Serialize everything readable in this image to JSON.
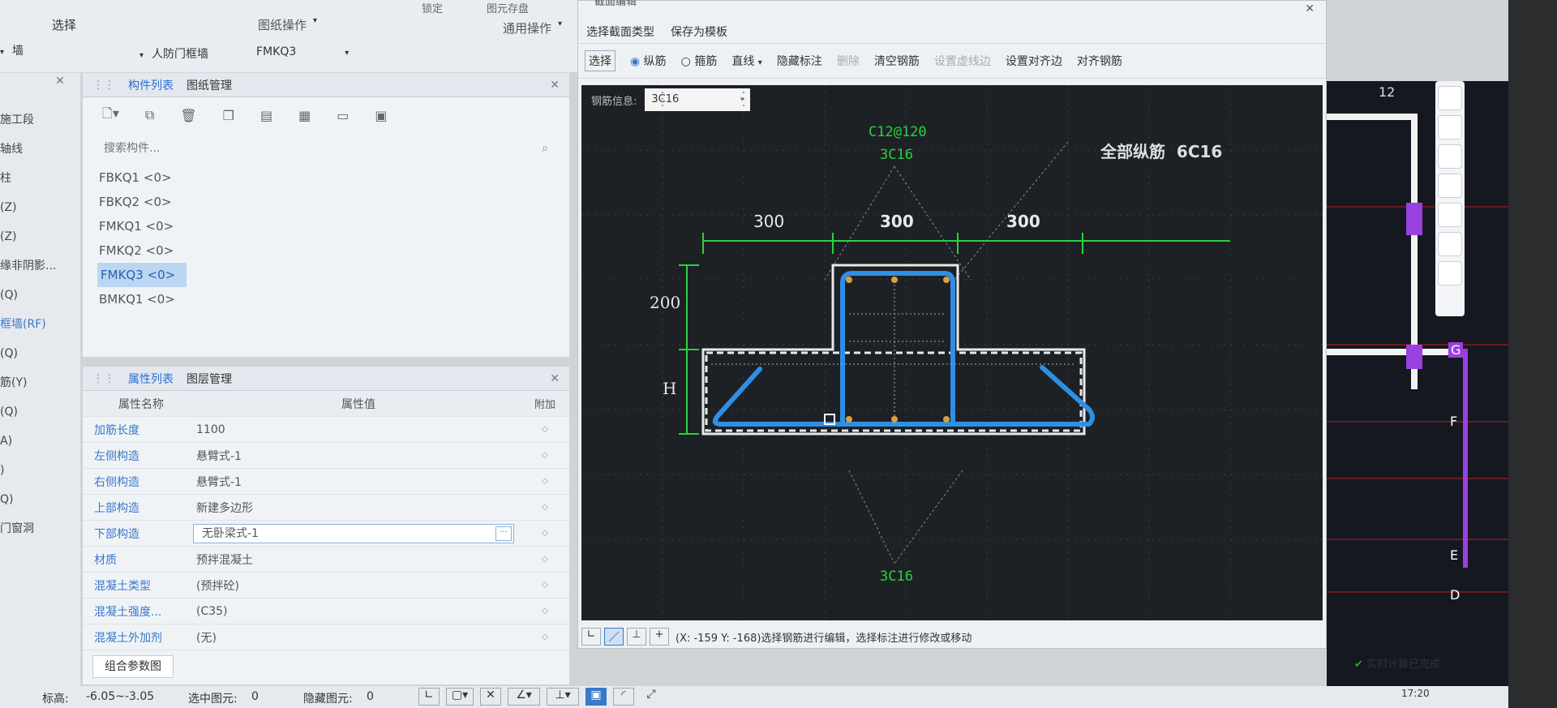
{
  "toolbar": {
    "select_label": "选择",
    "drawing_ops": "图纸操作",
    "general_ops": "通用操作",
    "wall_label": "墙",
    "cat_label": "人防门框墙",
    "comp_label": "FMKQ3",
    "lock_label": "锁定",
    "save_label": "图元存盘"
  },
  "left_menu": [
    "施工段",
    "轴线",
    "柱",
    "(Z)",
    "(Z)",
    "缘非阴影...",
    "(Q)",
    "框墙(RF)",
    "(Q)",
    "筋(Y)",
    "(Q)",
    "A)",
    ")",
    "Q)",
    "门窗洞"
  ],
  "component_panel": {
    "tabs": [
      "构件列表",
      "图纸管理"
    ],
    "search_placeholder": "搜索构件...",
    "items": [
      "FBKQ1 <0>",
      "FBKQ2 <0>",
      "FMKQ1 <0>",
      "FMKQ2 <0>",
      "FMKQ3 <0>",
      "BMKQ1 <0>"
    ],
    "selected_index": 4
  },
  "property_panel": {
    "tabs": [
      "属性列表",
      "图层管理"
    ],
    "headers": [
      "属性名称",
      "属性值",
      "附加"
    ],
    "rows": [
      {
        "name": "加筋长度",
        "value": "1100"
      },
      {
        "name": "左侧构造",
        "value": "悬臂式-1"
      },
      {
        "name": "右侧构造",
        "value": "悬臂式-1"
      },
      {
        "name": "上部构造",
        "value": "新建多边形"
      },
      {
        "name": "下部构造",
        "value": "无卧梁式-1"
      },
      {
        "name": "材质",
        "value": "预拌混凝土"
      },
      {
        "name": "混凝土类型",
        "value": "(预拌砼)"
      },
      {
        "name": "混凝土强度...",
        "value": "(C35)"
      },
      {
        "name": "混凝土外加剂",
        "value": "(无)"
      }
    ],
    "combine_btn": "组合参数图"
  },
  "dialog": {
    "title": "截面编辑",
    "menu": [
      "选择截面类型",
      "保存为模板"
    ],
    "toolbar": {
      "select": "选择",
      "radio_long": "纵筋",
      "radio_stir": "箍筋",
      "line": "直线",
      "hide_label": "隐藏标注",
      "delete": "删除",
      "clear": "清空钢筋",
      "set_dash": "设置虚线边",
      "set_align": "设置对齐边",
      "align_rebar": "对齐钢筋"
    },
    "rebar_info_label": "钢筋信息:",
    "rebar_info_value": "3C16",
    "status_text": "(X: -159 Y: -168)选择钢筋进行编辑，选择标注进行修改或移动"
  },
  "cad": {
    "label_top1": "C12@120",
    "label_top2": "3C16",
    "label_all": "全部纵筋  6C16",
    "dim1": "300",
    "dim2": "300",
    "dim3": "300",
    "dim_left": "200",
    "dim_h": "H",
    "label_bottom": "3C16"
  },
  "bottom_status": {
    "elev_label": "标高:",
    "elev_value": "-6.05~-3.05",
    "selected_label": "选中图元:",
    "selected_value": "0",
    "hidden_label": "隐藏图元:",
    "hidden_value": "0"
  },
  "right_view": {
    "axis_12": "12",
    "axis_G": "G",
    "axis_F": "F",
    "axis_E": "E",
    "axis_D": "D",
    "calc_status": "实时计算已完成",
    "time": "17:20"
  }
}
